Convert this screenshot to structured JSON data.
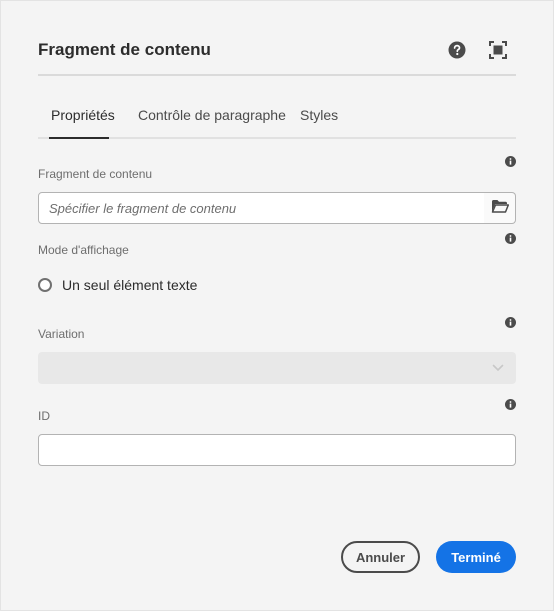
{
  "dialog": {
    "title": "Fragment de contenu",
    "header_icons": [
      "help-icon",
      "fullscreen-icon"
    ]
  },
  "tabs": [
    {
      "label": "Propriétés",
      "active": true
    },
    {
      "label": "Contrôle de paragraphe",
      "active": false
    },
    {
      "label": "Styles",
      "active": false
    }
  ],
  "fields": {
    "content_fragment": {
      "label": "Fragment de contenu",
      "placeholder": "Spécifier le fragment de contenu",
      "value": "",
      "browse_icon": "folder-icon"
    },
    "display_mode": {
      "label": "Mode d'affichage",
      "option": "Un seul élément texte",
      "selected": false
    },
    "variation": {
      "label": "Variation",
      "value": "",
      "disabled": true
    },
    "id": {
      "label": "ID",
      "value": ""
    }
  },
  "footer": {
    "cancel_label": "Annuler",
    "done_label": "Terminé"
  },
  "colors": {
    "accent": "#1473e6",
    "text": "#2c2c2c",
    "muted": "#6e6e6e"
  }
}
